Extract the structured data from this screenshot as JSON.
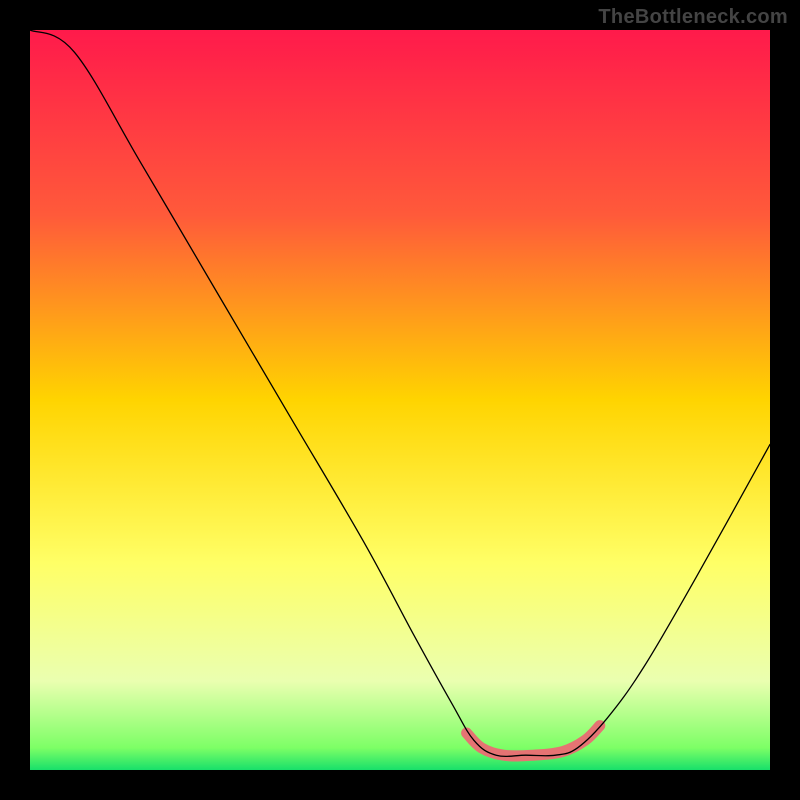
{
  "watermark": "TheBottleneck.com",
  "chart_data": {
    "type": "line",
    "title": "",
    "xlabel": "",
    "ylabel": "",
    "xlim": [
      0,
      100
    ],
    "ylim": [
      0,
      100
    ],
    "background_gradient": {
      "stops": [
        {
          "offset": 0,
          "color": "#ff1a4b"
        },
        {
          "offset": 25,
          "color": "#ff5a3a"
        },
        {
          "offset": 50,
          "color": "#ffd400"
        },
        {
          "offset": 72,
          "color": "#ffff66"
        },
        {
          "offset": 88,
          "color": "#eaffb0"
        },
        {
          "offset": 97,
          "color": "#7dff66"
        },
        {
          "offset": 100,
          "color": "#18e06a"
        }
      ]
    },
    "series": [
      {
        "name": "bottleneck-curve",
        "color": "#000000",
        "width": 1.3,
        "points": [
          {
            "x": 0,
            "y": 100
          },
          {
            "x": 6,
            "y": 97
          },
          {
            "x": 15,
            "y": 82
          },
          {
            "x": 25,
            "y": 65
          },
          {
            "x": 35,
            "y": 48
          },
          {
            "x": 45,
            "y": 31
          },
          {
            "x": 52,
            "y": 18
          },
          {
            "x": 57,
            "y": 9
          },
          {
            "x": 60,
            "y": 4
          },
          {
            "x": 63,
            "y": 2
          },
          {
            "x": 67,
            "y": 2
          },
          {
            "x": 71,
            "y": 2
          },
          {
            "x": 74,
            "y": 3
          },
          {
            "x": 78,
            "y": 7
          },
          {
            "x": 83,
            "y": 14
          },
          {
            "x": 90,
            "y": 26
          },
          {
            "x": 100,
            "y": 44
          }
        ]
      },
      {
        "name": "highlight-band",
        "color": "#e57373",
        "width": 11,
        "cap": "round",
        "points": [
          {
            "x": 59,
            "y": 5
          },
          {
            "x": 61,
            "y": 3
          },
          {
            "x": 64,
            "y": 2
          },
          {
            "x": 68,
            "y": 2
          },
          {
            "x": 72,
            "y": 2.5
          },
          {
            "x": 75,
            "y": 4
          },
          {
            "x": 77,
            "y": 6
          }
        ]
      }
    ]
  }
}
